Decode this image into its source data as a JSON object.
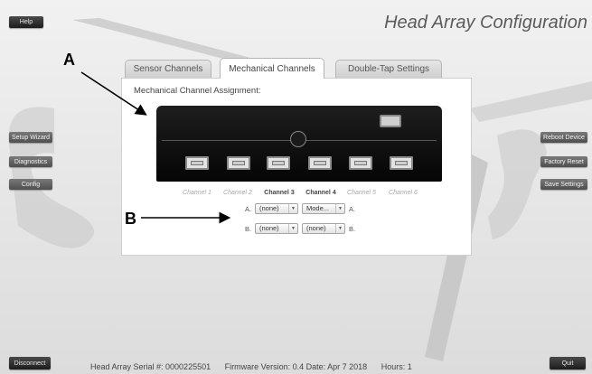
{
  "header": {
    "title": "Head Array Configuration",
    "help_label": "Help"
  },
  "left_menu": {
    "setup_wizard": "Setup Wizard",
    "diagnostics": "Diagnostics",
    "config": "Config"
  },
  "right_menu": {
    "reboot_device": "Reboot Device",
    "factory_reset": "Factory Reset",
    "save_settings": "Save Settings"
  },
  "tabs": [
    {
      "label": "Sensor Channels",
      "active": false
    },
    {
      "label": "Mechanical Channels",
      "active": true
    },
    {
      "label": "Double-Tap Settings",
      "active": false
    }
  ],
  "panel": {
    "title": "Mechanical Channel Assignment:"
  },
  "channels": [
    {
      "label": "Channel 1",
      "active": false
    },
    {
      "label": "Channel 2",
      "active": false
    },
    {
      "label": "Channel 3",
      "active": true
    },
    {
      "label": "Channel 4",
      "active": true
    },
    {
      "label": "Channel 5",
      "active": false
    },
    {
      "label": "Channel 6",
      "active": false
    }
  ],
  "assignments": {
    "row_a_label": "A.",
    "row_a_end_label": "A.",
    "row_b_label": "B.",
    "row_b_end_label": "B.",
    "ch3_a": "(none)",
    "ch4_a": "Mode...",
    "ch3_b": "(none)",
    "ch4_b": "(none)"
  },
  "annotations": {
    "callout_a": "A",
    "callout_b": "B"
  },
  "footer": {
    "disconnect_label": "Disconnect",
    "quit_label": "Quit",
    "serial": "Head Array Serial #: 0000225501",
    "firmware": "Firmware Version: 0.4 Date: Apr  7 2018",
    "hours": "Hours: 1"
  },
  "colors": {
    "background": "#e9e9e9",
    "button_dark": "#2a2a2a",
    "button_grey": "#5e5e5e",
    "panel": "#ffffff",
    "device_body": "#0f0f0f"
  }
}
